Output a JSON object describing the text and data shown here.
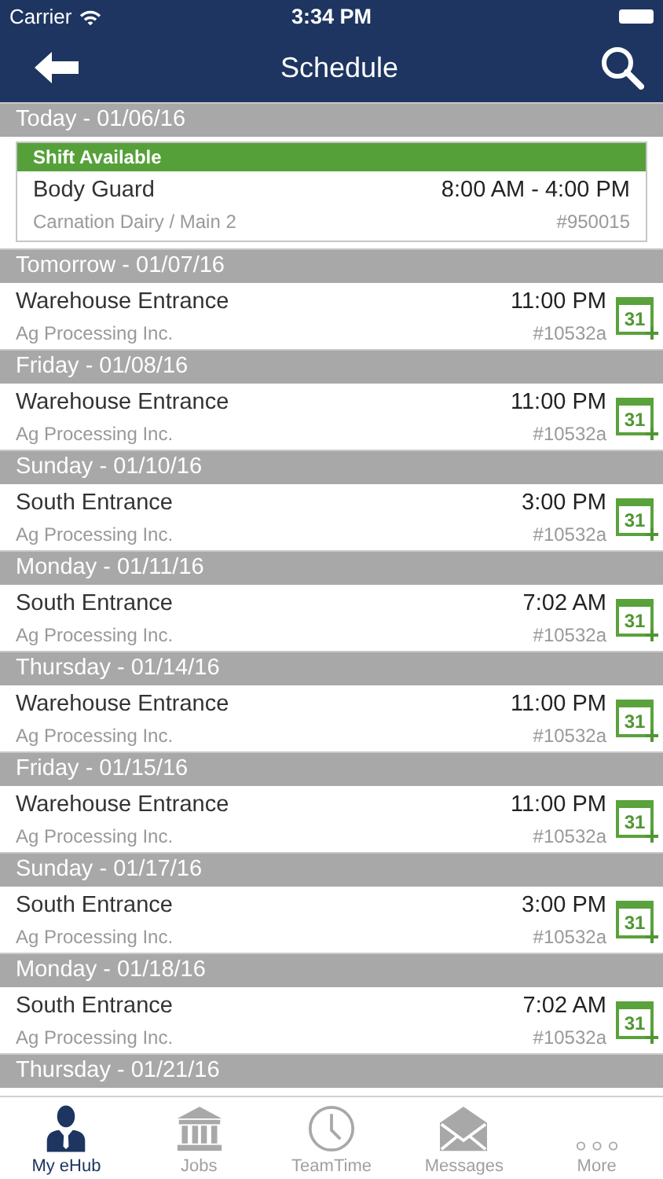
{
  "status_bar": {
    "carrier": "Carrier",
    "time": "3:34 PM"
  },
  "nav": {
    "title": "Schedule"
  },
  "sections": [
    {
      "header": "Today - 01/06/16",
      "items": [
        {
          "kind": "available",
          "banner": "Shift Available",
          "title": "Body Guard",
          "time": "8:00 AM - 4:00 PM",
          "subtitle": "Carnation Dairy / Main 2",
          "number": "#950015"
        }
      ]
    },
    {
      "header": "Tomorrow - 01/07/16",
      "items": [
        {
          "kind": "shift",
          "title": "Warehouse Entrance",
          "time": "11:00 PM",
          "subtitle": "Ag Processing Inc.",
          "number": "#10532a",
          "calendar": "31"
        }
      ]
    },
    {
      "header": "Friday - 01/08/16",
      "items": [
        {
          "kind": "shift",
          "title": "Warehouse Entrance",
          "time": "11:00 PM",
          "subtitle": "Ag Processing Inc.",
          "number": "#10532a",
          "calendar": "31"
        }
      ]
    },
    {
      "header": "Sunday - 01/10/16",
      "items": [
        {
          "kind": "shift",
          "title": "South Entrance",
          "time": "3:00 PM",
          "subtitle": "Ag Processing Inc.",
          "number": "#10532a",
          "calendar": "31"
        }
      ]
    },
    {
      "header": "Monday - 01/11/16",
      "items": [
        {
          "kind": "shift",
          "title": "South Entrance",
          "time": "7:02 AM",
          "subtitle": "Ag Processing Inc.",
          "number": "#10532a",
          "calendar": "31"
        }
      ]
    },
    {
      "header": "Thursday - 01/14/16",
      "items": [
        {
          "kind": "shift",
          "title": "Warehouse Entrance",
          "time": "11:00 PM",
          "subtitle": "Ag Processing Inc.",
          "number": "#10532a",
          "calendar": "31"
        }
      ]
    },
    {
      "header": "Friday - 01/15/16",
      "items": [
        {
          "kind": "shift",
          "title": "Warehouse Entrance",
          "time": "11:00 PM",
          "subtitle": "Ag Processing Inc.",
          "number": "#10532a",
          "calendar": "31"
        }
      ]
    },
    {
      "header": "Sunday - 01/17/16",
      "items": [
        {
          "kind": "shift",
          "title": "South Entrance",
          "time": "3:00 PM",
          "subtitle": "Ag Processing Inc.",
          "number": "#10532a",
          "calendar": "31"
        }
      ]
    },
    {
      "header": "Monday - 01/18/16",
      "items": [
        {
          "kind": "shift",
          "title": "South Entrance",
          "time": "7:02 AM",
          "subtitle": "Ag Processing Inc.",
          "number": "#10532a",
          "calendar": "31"
        }
      ]
    },
    {
      "header": "Thursday - 01/21/16"
    }
  ],
  "tab_bar": [
    {
      "kind": "person",
      "label": "My eHub",
      "selected": true
    },
    {
      "kind": "bank",
      "label": "Jobs",
      "selected": false
    },
    {
      "kind": "clock",
      "label": "TeamTime",
      "selected": false
    },
    {
      "kind": "mail",
      "label": "Messages",
      "selected": false
    },
    {
      "kind": "more",
      "label": "More",
      "selected": false
    }
  ]
}
